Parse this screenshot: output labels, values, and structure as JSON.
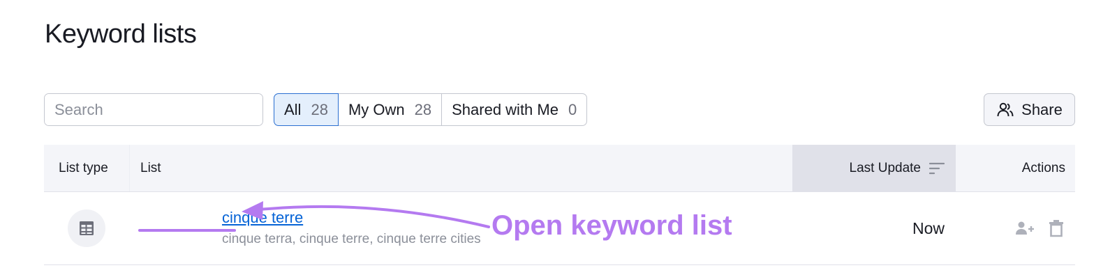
{
  "page": {
    "title": "Keyword lists"
  },
  "search": {
    "placeholder": "Search"
  },
  "tabs": [
    {
      "label": "All",
      "count": "28",
      "active": true
    },
    {
      "label": "My Own",
      "count": "28",
      "active": false
    },
    {
      "label": "Shared with Me",
      "count": "0",
      "active": false
    }
  ],
  "share_button": {
    "label": "Share"
  },
  "table": {
    "columns": {
      "list_type": "List type",
      "list": "List",
      "last_update": "Last Update",
      "actions": "Actions"
    },
    "rows": [
      {
        "name": "cinque terre",
        "keywords": "cinque terra, cinque terre, cinque terre cities",
        "last_update": "Now"
      }
    ]
  },
  "annotation": {
    "text": "Open keyword list",
    "color": "#b47af0"
  },
  "colors": {
    "accent": "#2a6ed1",
    "link": "#0563d6",
    "muted": "#8b8f99",
    "annotation": "#b47af0"
  },
  "icons": [
    "search-icon",
    "share-users-icon",
    "sort-icon",
    "table-list-icon",
    "add-user-icon",
    "trash-icon"
  ]
}
